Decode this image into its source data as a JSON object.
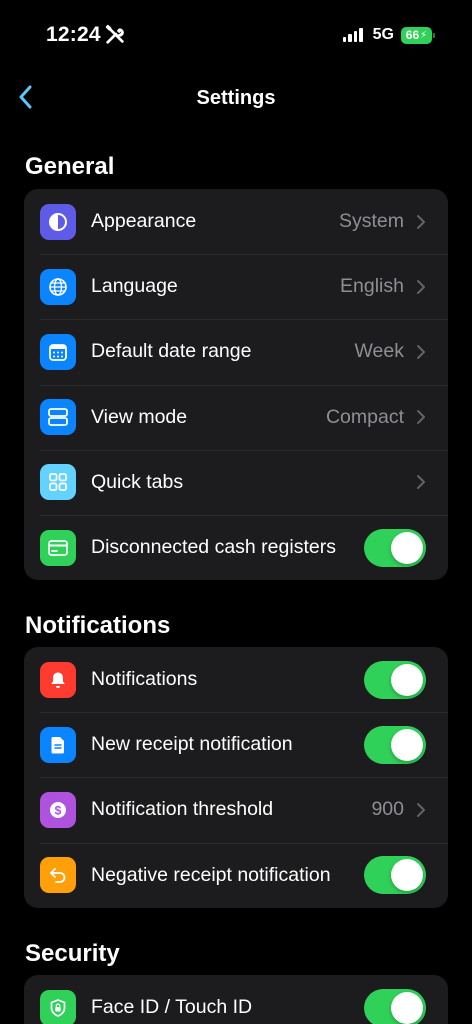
{
  "status_bar": {
    "time": "12:24",
    "network": "5G",
    "battery": "66"
  },
  "nav": {
    "title": "Settings"
  },
  "colors": {
    "accent": "#0a84ff",
    "toggle_on": "#30d158",
    "group_bg": "#1c1c1e",
    "icon_purple": "#5e5ce6",
    "icon_blue": "#0a84ff",
    "icon_teal": "#64d2ff",
    "icon_green": "#30d158",
    "icon_red": "#ff3b30",
    "icon_violet": "#af52de",
    "icon_orange": "#ff9f0a"
  },
  "general": {
    "header": "General",
    "rows": [
      {
        "label": "Appearance",
        "value": "System",
        "icon": "appearance-icon"
      },
      {
        "label": "Language",
        "value": "English",
        "icon": "globe-icon"
      },
      {
        "label": "Default date range",
        "value": "Week",
        "icon": "calendar-icon"
      },
      {
        "label": "View mode",
        "value": "Compact",
        "icon": "view-mode-icon"
      },
      {
        "label": "Quick tabs",
        "value": "",
        "icon": "grid-icon"
      },
      {
        "label": "Disconnected cash registers",
        "toggle": true,
        "icon": "card-icon"
      }
    ]
  },
  "notifications": {
    "header": "Notifications",
    "rows": [
      {
        "label": "Notifications",
        "toggle": true,
        "icon": "bell-icon"
      },
      {
        "label": "New receipt notification",
        "toggle": true,
        "icon": "document-icon"
      },
      {
        "label": "Notification threshold",
        "value": "900",
        "icon": "dollar-icon"
      },
      {
        "label": "Negative receipt notification",
        "toggle": true,
        "icon": "return-arrow-icon"
      }
    ]
  },
  "security": {
    "header": "Security",
    "rows": [
      {
        "label": "Face ID / Touch ID",
        "toggle": true,
        "icon": "shield-lock-icon"
      }
    ]
  }
}
